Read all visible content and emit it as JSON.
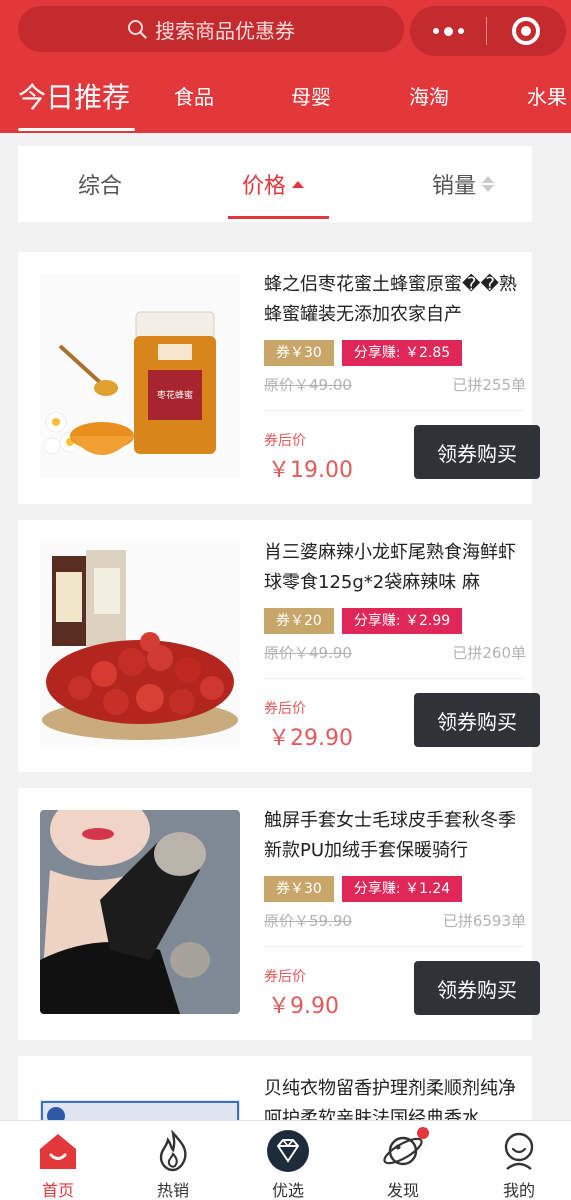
{
  "header": {
    "search_placeholder": "搜索商品优惠券",
    "brand_color": "#e3383b",
    "more_icon": "more-dots-icon",
    "close_icon": "miniprogram-close-icon"
  },
  "categories": [
    {
      "label": "今日推荐",
      "active": true
    },
    {
      "label": "食品",
      "active": false
    },
    {
      "label": "母婴",
      "active": false
    },
    {
      "label": "海淘",
      "active": false
    },
    {
      "label": "水果",
      "active": false
    }
  ],
  "sort": {
    "items": [
      {
        "label": "综合",
        "active": false
      },
      {
        "label": "价格",
        "active": true
      },
      {
        "label": "销量",
        "active": false
      }
    ]
  },
  "products": [
    {
      "title": "蜂之侣枣花蜜土蜂蜜原蜜��熟蜂蜜罐装无添加农家自产",
      "coupon": "券￥30",
      "share": "分享赚: ￥2.85",
      "original_price": "原价￥49.00",
      "sold": "已拼255单",
      "after_label": "券后价",
      "after_price": "￥19.00",
      "buy_label": "领券购买",
      "image": "honey-jar"
    },
    {
      "title": "肖三婆麻辣小龙虾尾熟食海鲜虾球零食125g*2袋麻辣味 麻",
      "coupon": "券￥20",
      "share": "分享赚: ￥2.99",
      "original_price": "原价￥49.90",
      "sold": "已拼260单",
      "after_label": "券后价",
      "after_price": "￥29.90",
      "buy_label": "领券购买",
      "image": "crayfish-bowl"
    },
    {
      "title": "触屏手套女士毛球皮手套秋冬季新款PU加绒手套保暖骑行",
      "coupon": "券￥30",
      "share": "分享赚: ￥1.24",
      "original_price": "原价￥59.90",
      "sold": "已拼6593单",
      "after_label": "券后价",
      "after_price": "￥9.90",
      "buy_label": "领券购买",
      "image": "woman-gloves"
    },
    {
      "title": "贝纯衣物留香护理剂柔顺剂纯净呵护柔软亲肤法国经典香水",
      "coupon": "",
      "share": "",
      "original_price": "",
      "sold": "",
      "after_label": "",
      "after_price": "",
      "buy_label": "",
      "image": "softener-bottles"
    }
  ],
  "bottom_nav": [
    {
      "label": "首页",
      "icon": "home-icon",
      "active": true
    },
    {
      "label": "热销",
      "icon": "flame-icon",
      "active": false
    },
    {
      "label": "优选",
      "icon": "diamond-icon",
      "active": false
    },
    {
      "label": "发现",
      "icon": "planet-icon",
      "active": false,
      "badge": true
    },
    {
      "label": "我的",
      "icon": "profile-icon",
      "active": false
    }
  ]
}
